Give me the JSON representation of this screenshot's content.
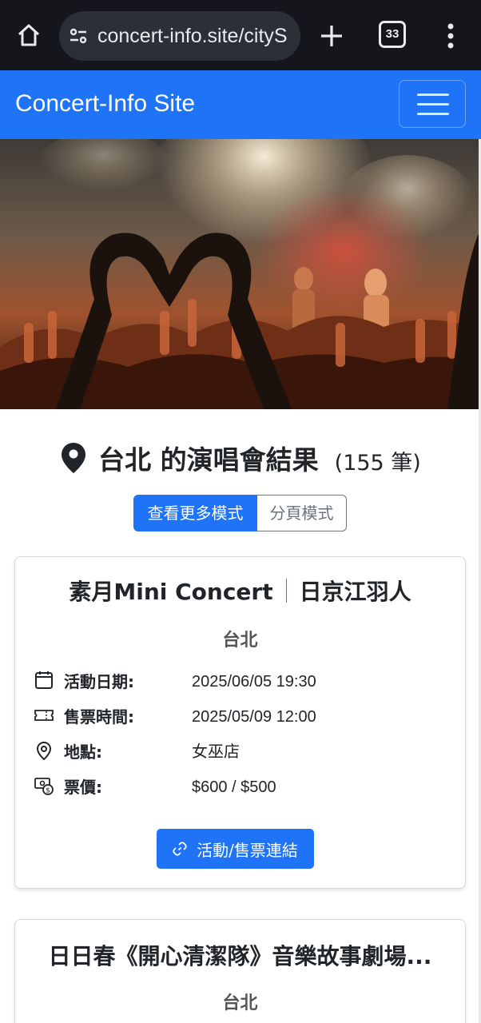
{
  "browser": {
    "url": "concert-info.site/cityS",
    "tab_count": "33"
  },
  "navbar": {
    "brand": "Concert-Info Site"
  },
  "results": {
    "city_heading": "台北 的演唱會結果",
    "count": "(155 筆)"
  },
  "modes": {
    "load_more": "查看更多模式",
    "pagination": "分頁模式"
  },
  "cards": [
    {
      "title_left": "素月Mini Concert",
      "title_right": "日京江羽人",
      "city": "台北",
      "event_date_label": "活動日期:",
      "event_date": "2025/06/05 19:30",
      "ticket_time_label": "售票時間:",
      "ticket_time": "2025/05/09 12:00",
      "venue_label": "地點:",
      "venue": "女巫店",
      "price_label": "票價:",
      "price": "$600 / $500",
      "link_label": "活動/售票連結"
    },
    {
      "title": "日日春《開心清潔隊》音樂故事劇場...",
      "city": "台北"
    }
  ],
  "colors": {
    "primary": "#1f73f7",
    "browser_bg": "#14161b"
  }
}
